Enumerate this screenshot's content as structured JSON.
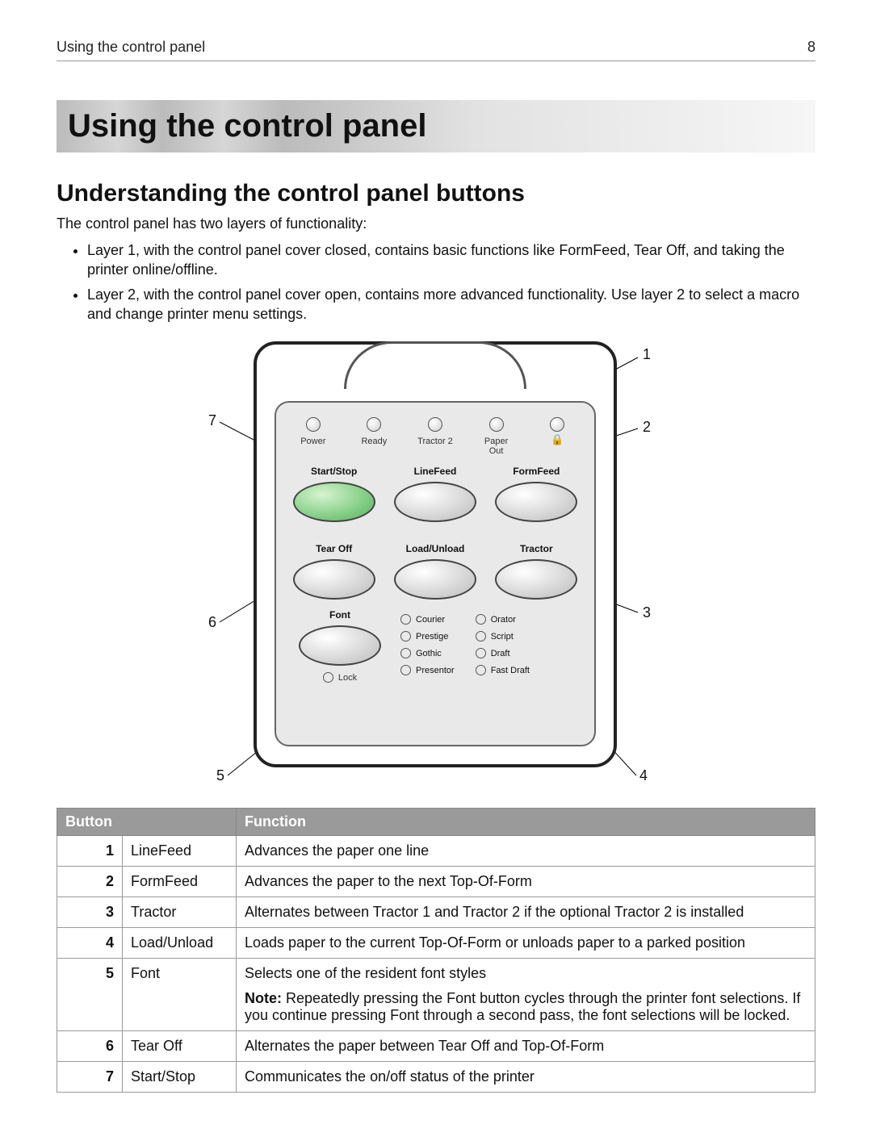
{
  "header": {
    "left": "Using the control panel",
    "right": "8"
  },
  "title": "Using the control panel",
  "section": "Understanding the control panel buttons",
  "intro": "The control panel has two layers of functionality:",
  "bullets": [
    "Layer 1, with the control panel cover closed, contains basic functions like FormFeed, Tear Off, and taking the printer online/offline.",
    "Layer 2, with the control panel cover open, contains more advanced functionality. Use layer 2 to select a macro and change printer menu settings."
  ],
  "panel": {
    "leds": [
      "Power",
      "Ready",
      "Tractor 2",
      "Paper\nOut",
      ""
    ],
    "row1": [
      "Start/Stop",
      "LineFeed",
      "FormFeed"
    ],
    "row2": [
      "Tear Off",
      "Load/Unload",
      "Tractor"
    ],
    "fontLabel": "Font",
    "lockLabel": "Lock",
    "fonts": [
      "Courier",
      "Orator",
      "Prestige",
      "Script",
      "Gothic",
      "Draft",
      "Presentor",
      "Fast Draft"
    ]
  },
  "callouts": {
    "n1": "1",
    "n2": "2",
    "n3": "3",
    "n4": "4",
    "n5": "5",
    "n6": "6",
    "n7": "7"
  },
  "tableHead": {
    "c1": "Button",
    "c2": "Function"
  },
  "rows": [
    {
      "n": "1",
      "b": "LineFeed",
      "f": "Advances the paper one line"
    },
    {
      "n": "2",
      "b": "FormFeed",
      "f": "Advances the paper to the next Top-Of-Form"
    },
    {
      "n": "3",
      "b": "Tractor",
      "f": "Alternates between Tractor 1 and Tractor 2 if the optional Tractor 2 is installed"
    },
    {
      "n": "4",
      "b": "Load/Unload",
      "f": "Loads paper to the current Top-Of-Form or unloads paper to a parked position"
    },
    {
      "n": "5",
      "b": "Font",
      "f": "Selects one of the resident font styles",
      "note_label": "Note:",
      "note": " Repeatedly pressing the Font button cycles through the printer font selections. If you continue pressing Font through a second pass, the font selections will be locked."
    },
    {
      "n": "6",
      "b": "Tear Off",
      "f": "Alternates the paper between Tear Off and Top-Of-Form"
    },
    {
      "n": "7",
      "b": "Start/Stop",
      "f": "Communicates the on/off status of the printer"
    }
  ]
}
